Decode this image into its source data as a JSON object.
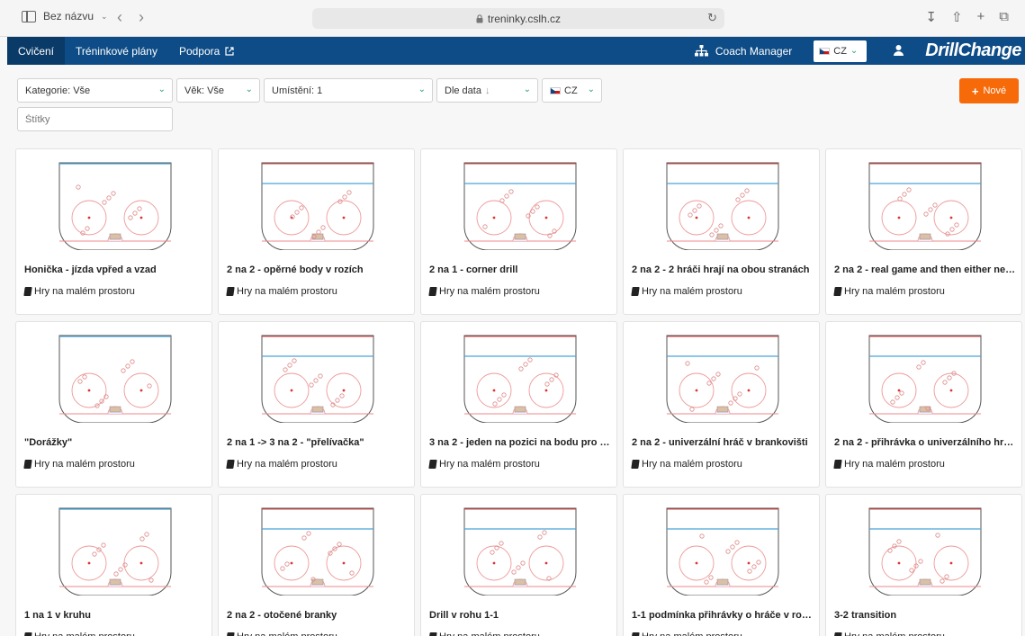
{
  "browser": {
    "tab_title": "Bez názvu",
    "url": "treninky.cslh.cz"
  },
  "navbar": {
    "items": [
      {
        "label": "Cvičení"
      },
      {
        "label": "Tréninkové plány"
      },
      {
        "label": "Podpora"
      }
    ],
    "coach_label": "Coach Manager",
    "lang": "CZ",
    "brand": "DrillChange",
    "accent_color": "#0d4c86"
  },
  "filters": {
    "category": "Kategorie: Vše",
    "age": "Věk: Vše",
    "location": "Umístění: 1",
    "sort": "Dle data",
    "lang": "CZ",
    "tags_placeholder": "Štítky",
    "new_label": "Nové",
    "new_color": "#f66a0a"
  },
  "drills": [
    {
      "title": "Honička - jízda vpřed a vzad",
      "category": "Hry na malém prostoru"
    },
    {
      "title": "2 na 2 - opěrné body v rozích",
      "category": "Hry na malém prostoru"
    },
    {
      "title": "2 na 1 - corner drill",
      "category": "Hry na malém prostoru"
    },
    {
      "title": "2 na 2 - 2 hráči hrají na obou stranách",
      "category": "Hry na malém prostoru"
    },
    {
      "title": "2 na 2 - real game and then either net ...",
      "category": "Hry na malém prostoru"
    },
    {
      "title": "\"Dorážky\"",
      "category": "Hry na malém prostoru"
    },
    {
      "title": "2 na 1 -> 3 na 2 - \"přelívačka\"",
      "category": "Hry na malém prostoru"
    },
    {
      "title": "3 na 2 - jeden na pozici na bodu pro vh...",
      "category": "Hry na malém prostoru"
    },
    {
      "title": "2 na 2 - univerzální hráč v brankovišti",
      "category": "Hry na malém prostoru"
    },
    {
      "title": "2 na 2 - přihrávka o univerzálního hráče",
      "category": "Hry na malém prostoru"
    },
    {
      "title": "1 na 1 v kruhu",
      "category": "Hry na malém prostoru"
    },
    {
      "title": "2 na 2 - otočené branky",
      "category": "Hry na malém prostoru"
    },
    {
      "title": "Drill v rohu 1-1",
      "category": "Hry na malém prostoru"
    },
    {
      "title": "1-1 podmínka přihrávky o hráče v rohu",
      "category": "Hry na malém prostoru"
    },
    {
      "title": "3-2 transition",
      "category": "Hry na malém prostoru"
    }
  ]
}
